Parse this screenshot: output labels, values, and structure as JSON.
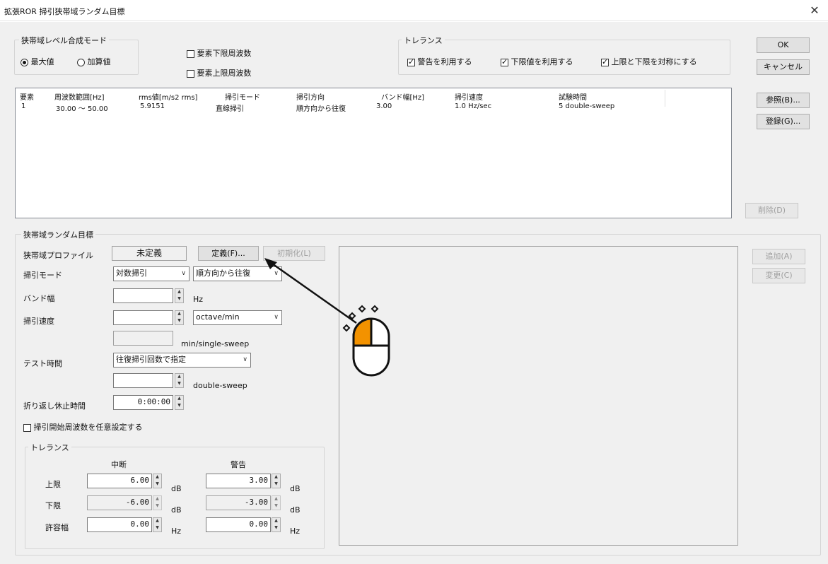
{
  "window": {
    "title": "拡張ROR 掃引狭帯域ランダム目標",
    "close_icon": "close-icon"
  },
  "mode_group": {
    "legend": "狭帯域レベル合成モード",
    "options": [
      {
        "label": "最大値",
        "selected": true
      },
      {
        "label": "加算値",
        "selected": false
      }
    ]
  },
  "element_checks": {
    "lower": {
      "label": "要素下限周波数",
      "checked": false
    },
    "upper": {
      "label": "要素上限周波数",
      "checked": false
    }
  },
  "tolerance_group": {
    "legend": "トレランス",
    "warn": {
      "label": "警告を利用する",
      "checked": true
    },
    "lower": {
      "label": "下限値を利用する",
      "checked": true
    },
    "symmetric": {
      "label": "上限と下限を対称にする",
      "checked": true
    }
  },
  "buttons": {
    "ok": "OK",
    "cancel": "キャンセル",
    "browse": "参照(B)...",
    "register": "登録(G)...",
    "delete": "削除(D)",
    "add": "追加(A)",
    "change": "変更(C)",
    "define": "定義(F)...",
    "init": "初期化(L)"
  },
  "table": {
    "headers": [
      "要素",
      "周波数範囲[Hz]",
      "rms値[m/s2 rms]",
      "掃引モード",
      "掃引方向",
      "バンド幅[Hz]",
      "掃引速度",
      "試験時間"
    ],
    "rows": [
      [
        "1",
        "30.00 ～ 50.00",
        "5.9151",
        "直線掃引",
        "順方向から往復",
        "3.00",
        "1.0 Hz/sec",
        "5 double-sweep"
      ]
    ]
  },
  "target_group": {
    "legend": "狭帯域ランダム目標",
    "profile_label": "狭帯域プロファイル",
    "profile_value": "未定義",
    "sweep_mode_label": "掃引モード",
    "sweep_mode_value": "対数掃引",
    "sweep_dir_value": "順方向から往復",
    "bandwidth_label": "バンド幅",
    "bandwidth_unit": "Hz",
    "sweep_speed_label": "掃引速度",
    "sweep_speed_unit_value": "octave/min",
    "single_sweep_unit": "min/single-sweep",
    "test_time_label": "テスト時間",
    "test_time_mode": "往復掃引回数で指定",
    "double_sweep_unit": "double-sweep",
    "turn_rest_label": "折り返し休止時間",
    "turn_rest_value": "0:00:00",
    "start_freq_check": {
      "label": "掃引開始周波数を任意設定する",
      "checked": false
    }
  },
  "inner_tolerance": {
    "legend": "トレランス",
    "col_abort": "中断",
    "col_warn": "警告",
    "rows": [
      {
        "label": "上限",
        "abort": "6.00",
        "warn": "3.00",
        "unit": "dB",
        "disabled": false
      },
      {
        "label": "下限",
        "abort": "-6.00",
        "warn": "-3.00",
        "unit": "dB",
        "disabled": true
      },
      {
        "label": "許容幅",
        "abort": "0.00",
        "warn": "0.00",
        "unit": "Hz",
        "disabled": false
      }
    ]
  },
  "overlay": {
    "cursor_icon": "mouse-click-icon",
    "arrow_icon": "pointer-arrow-icon",
    "accent": "#f39200"
  }
}
